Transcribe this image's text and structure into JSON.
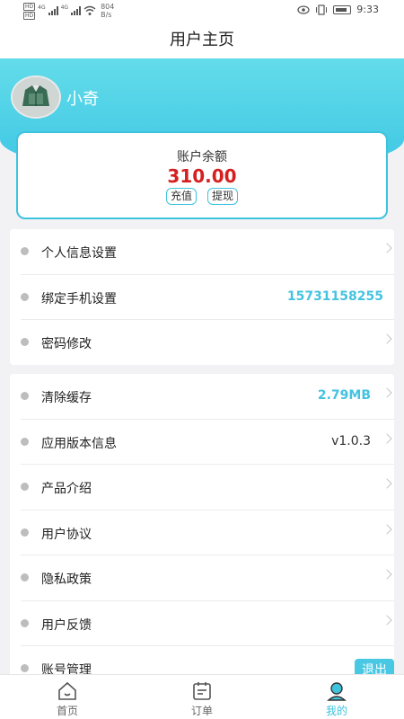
{
  "status_bar": {
    "net_speed_value": "804",
    "net_speed_unit": "B/s",
    "time": "9:33",
    "signal1": "4G",
    "signal2": "4G"
  },
  "header": {
    "title": "用户主页"
  },
  "profile": {
    "username": "小奇"
  },
  "balance": {
    "label": "账户余额",
    "amount": "310.00",
    "recharge_label": "充值",
    "withdraw_label": "提现"
  },
  "group1": [
    {
      "label": "个人信息设置",
      "value": "",
      "chevron": true
    },
    {
      "label": "绑定手机设置",
      "value": "15731158255",
      "chevron": false
    },
    {
      "label": "密码修改",
      "value": "",
      "chevron": true
    }
  ],
  "group2": [
    {
      "label": "清除缓存",
      "value": "2.79MB",
      "chevron": true
    },
    {
      "label": "应用版本信息",
      "value": "v1.0.3",
      "chevron": true
    },
    {
      "label": "产品介绍",
      "value": "",
      "chevron": true
    },
    {
      "label": "用户协议",
      "value": "",
      "chevron": true
    },
    {
      "label": "隐私政策",
      "value": "",
      "chevron": true
    },
    {
      "label": "用户反馈",
      "value": "",
      "chevron": true
    },
    {
      "label": "账号管理",
      "value": "",
      "chevron": false,
      "button": "退出"
    }
  ],
  "tabs": [
    {
      "label": "首页",
      "icon": "home-icon",
      "active": false
    },
    {
      "label": "订单",
      "icon": "order-icon",
      "active": false
    },
    {
      "label": "我的",
      "icon": "user-icon",
      "active": true
    }
  ],
  "colors": {
    "accent": "#3ec3df",
    "amount": "#d62020"
  }
}
